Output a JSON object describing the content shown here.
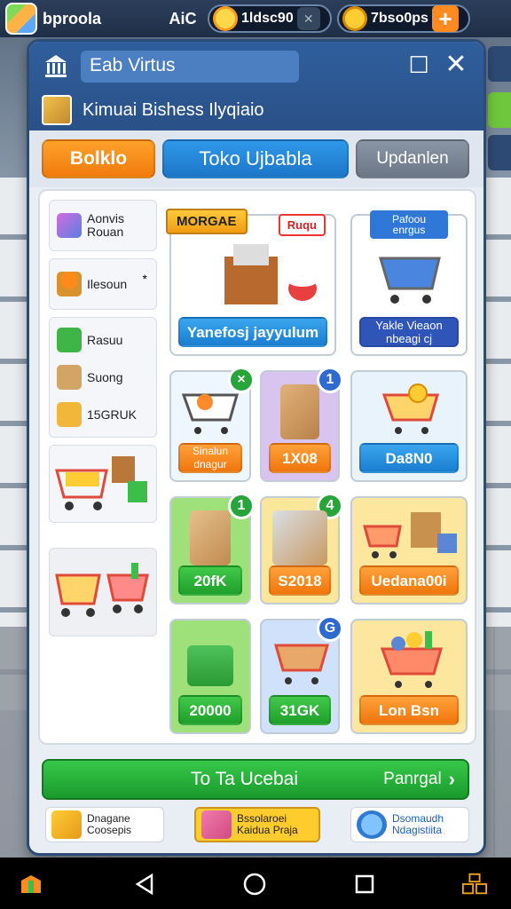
{
  "status_bar": {
    "app_name": "bproola",
    "level": "AiC",
    "energy_value": "1ldsc90",
    "coins_value": "7bso0ps",
    "plus": "+",
    "x_mark": "✕"
  },
  "dialog": {
    "search_value": "Eab Virtus",
    "subtitle": "Kimuai Bishess Ilyqiaio",
    "maximize": "☐",
    "close": "✕",
    "tabs": [
      "Bolklo",
      "Toko Ujbabla",
      "Updanlen"
    ]
  },
  "sidebar": {
    "item_1": "Aonvis\nRouan",
    "item_2": "Ilesoun",
    "item_3": "Rasuu",
    "item_4": "Suong",
    "item_5": "15GRUK",
    "star": "*"
  },
  "tiles": {
    "featured_ribbon": "MORGAE",
    "featured_price": "Ruqu",
    "featured_label": "Yanefosj jayyulum",
    "cart_sign": "Pafoou\nenrgus",
    "cart_label": "Yakle Vieaon\nnbeagi cj",
    "t1_label": "Sinalun\ndnagur",
    "t1_badge": "×",
    "t2_label": "1X08",
    "t2_badge": "1",
    "t3_label": "Da8N0",
    "t4_label": "20fK",
    "t4_badge": "1",
    "t5_label": "S2018",
    "t5_badge": "4",
    "t6_label": "Uedana00i",
    "t7_label": "20000",
    "t8_label": "31GK",
    "t8_badge": "G",
    "t9_label": "Lon Bsn"
  },
  "cta": {
    "left": "To Ta Ucebai",
    "right": "Panrgal",
    "arrow": "›"
  },
  "bottom": {
    "card_1": "Dnagane\nCoosepis",
    "card_2": "Bssolaroei\nKaidua Praja",
    "card_3": "Dsomaudh\nNdagistiita"
  },
  "colors": {
    "accent_orange": "#f07b0d",
    "accent_blue": "#1d76c8",
    "accent_green": "#1f9f2c",
    "header_blue": "#2a5188"
  }
}
